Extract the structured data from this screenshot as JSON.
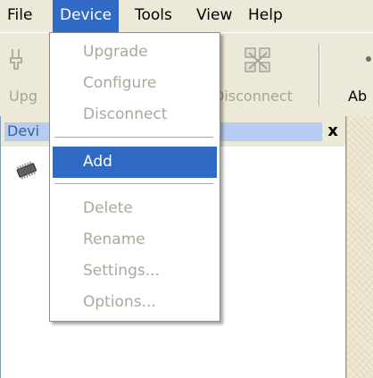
{
  "menubar": {
    "items": [
      {
        "label": "File"
      },
      {
        "label": "Device"
      },
      {
        "label": "Tools"
      },
      {
        "label": "View"
      },
      {
        "label": "Help"
      }
    ]
  },
  "toolbar": {
    "upgrade_label": "Upg",
    "disconnect_label": "Disconnect",
    "about_label": "Ab"
  },
  "panel": {
    "title": "Devi",
    "close_glyph": "x"
  },
  "device_menu": {
    "items": [
      {
        "label": "Upgrade",
        "enabled": false
      },
      {
        "label": "Configure",
        "enabled": false
      },
      {
        "label": "Disconnect",
        "enabled": false
      },
      {
        "label": "Add",
        "enabled": true,
        "highlighted": true
      },
      {
        "label": "Delete",
        "enabled": false
      },
      {
        "label": "Rename",
        "enabled": false
      },
      {
        "label": "Settings...",
        "enabled": false
      },
      {
        "label": "Options...",
        "enabled": false
      }
    ]
  },
  "colors": {
    "selection": "#316ac5",
    "disabled_text": "#aca899",
    "window_face": "#ece9d8"
  }
}
